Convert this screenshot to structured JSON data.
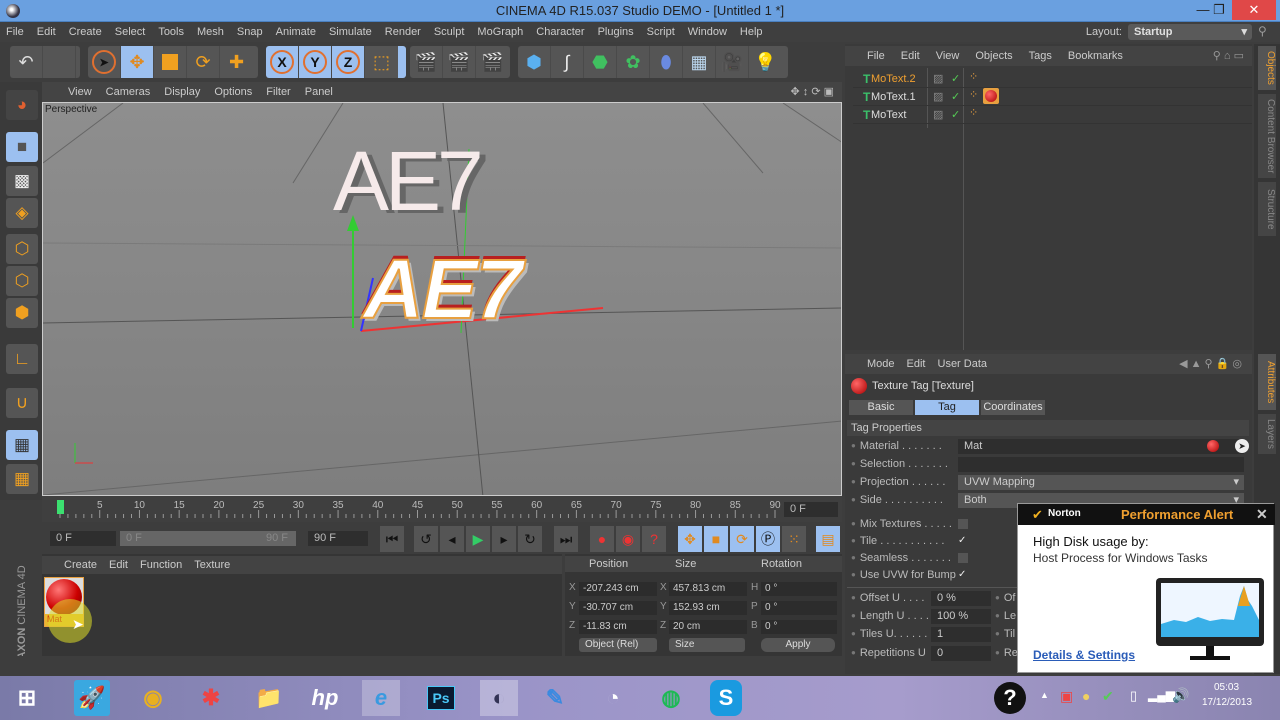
{
  "window": {
    "title": "CINEMA 4D R15.037 Studio DEMO - [Untitled 1 *]",
    "minimize_icon": "—",
    "restore_icon": "❐",
    "close_icon": "✕"
  },
  "menubar": [
    "File",
    "Edit",
    "Create",
    "Select",
    "Tools",
    "Mesh",
    "Snap",
    "Animate",
    "Simulate",
    "Render",
    "Sculpt",
    "MoGraph",
    "Character",
    "Plugins",
    "Script",
    "Window",
    "Help"
  ],
  "layout": {
    "label": "Layout:",
    "value": "Startup"
  },
  "toolbar": {
    "undo": "↶",
    "axis_x": "X",
    "axis_y": "Y",
    "axis_z": "Z"
  },
  "viewport": {
    "menu": [
      "View",
      "Cameras",
      "Display",
      "Options",
      "Filter",
      "Panel"
    ],
    "label": "Perspective",
    "text_top": "AE7",
    "text_bottom": "AE7",
    "nav_icons": "✥ ↕ ⟳ ▣"
  },
  "object_manager": {
    "menu": [
      "File",
      "Edit",
      "View",
      "Objects",
      "Tags",
      "Bookmarks"
    ],
    "objects": [
      {
        "name": "MoText.2",
        "selected": true,
        "has_material": false
      },
      {
        "name": "MoText.1",
        "selected": false,
        "has_material": true
      },
      {
        "name": "MoText",
        "selected": false,
        "has_material": false
      }
    ]
  },
  "side_tabs": {
    "objects": "Objects",
    "content_browser": "Content Browser",
    "structure": "Structure",
    "attributes": "Attributes",
    "layers": "Layers"
  },
  "attributes": {
    "menu": [
      "Mode",
      "Edit",
      "User Data"
    ],
    "header": "Texture Tag [Texture]",
    "tabs": [
      "Basic",
      "Tag",
      "Coordinates"
    ],
    "active_tab": "Tag",
    "section": "Tag Properties",
    "material_label": "Material . . . . . . .",
    "material_value": "Mat",
    "selection_label": "Selection . . . . . . .",
    "selection_value": "",
    "projection_label": "Projection . . . . . .",
    "projection_value": "UVW Mapping",
    "side_label": "Side . . . . . . . . . .",
    "side_value": "Both",
    "mix_textures_label": "Mix Textures . . . . .",
    "mix_textures": false,
    "tile_label": "Tile . . . . . . . . . . .",
    "tile": true,
    "seamless_label": "Seamless . . . . . . .",
    "seamless": false,
    "use_uvw_label": "Use UVW for Bump",
    "use_uvw": true,
    "offset_u_label": "Offset U . . . .",
    "offset_u": "0 %",
    "length_u_label": "Length U . . . .",
    "length_u": "100 %",
    "tiles_u_label": "Tiles U. . . . . .",
    "tiles_u": "1",
    "repetitions_u_label": "Repetitions U",
    "repetitions_u": "0",
    "offset_v_label": "Of",
    "length_v_label": "Le",
    "tiles_v_label": "Til",
    "repetitions_v_label": "Re"
  },
  "timeline": {
    "ticks": [
      "0",
      "5",
      "10",
      "15",
      "20",
      "25",
      "30",
      "35",
      "40",
      "45",
      "50",
      "55",
      "60",
      "65",
      "70",
      "75",
      "80",
      "85",
      "90"
    ],
    "current_frame_field": "0 F",
    "start_field": "0 F",
    "range_start": "0 F",
    "range_end": "90 F",
    "end_field": "90 F"
  },
  "material_manager": {
    "menu": [
      "Create",
      "Edit",
      "Function",
      "Texture"
    ],
    "materials": [
      {
        "name": "Mat"
      }
    ]
  },
  "coordinates": {
    "headers": [
      "Position",
      "Size",
      "Rotation"
    ],
    "rows": [
      {
        "pos_axis": "X",
        "pos": "-207.243 cm",
        "size_axis": "X",
        "size": "457.813 cm",
        "rot_axis": "H",
        "rot": "0 °"
      },
      {
        "pos_axis": "Y",
        "pos": "-30.707 cm",
        "size_axis": "Y",
        "size": "152.93 cm",
        "rot_axis": "P",
        "rot": "0 °"
      },
      {
        "pos_axis": "Z",
        "pos": "-11.83 cm",
        "size_axis": "Z",
        "size": "20 cm",
        "rot_axis": "B",
        "rot": "0 °"
      }
    ],
    "mode": "Object (Rel)",
    "size_mode": "Size",
    "apply": "Apply"
  },
  "brand": {
    "maxon": "MAXON",
    "cinema": "CINEMA 4D"
  },
  "norton": {
    "brand": "Norton",
    "title": "Performance Alert",
    "heading": "High Disk usage by:",
    "process": "Host Process for Windows Tasks",
    "link": "Details & Settings",
    "close": "✕"
  },
  "taskbar": {
    "apps": [
      "Start",
      "Rocket",
      "Webcam",
      "Games",
      "File Explorer",
      "HP",
      "Internet Explorer",
      "Photoshop",
      "Cinema 4D",
      "Editor",
      "Clock",
      "Spotify",
      "Skype"
    ],
    "time": "05:03",
    "date": "17/12/2013",
    "tray_up": "▲"
  }
}
